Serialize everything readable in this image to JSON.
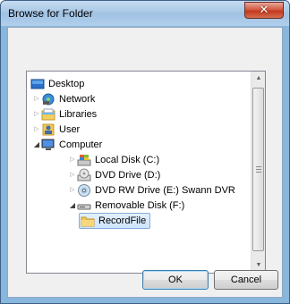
{
  "window": {
    "title": "Browse for Folder",
    "close_glyph": "✕"
  },
  "tree": {
    "items": [
      {
        "label": "Desktop",
        "icon": "desktop-icon",
        "expander": "none",
        "level": 0
      },
      {
        "label": "Network",
        "icon": "network-icon",
        "expander": "collapsed",
        "level": 1
      },
      {
        "label": "Libraries",
        "icon": "libraries-icon",
        "expander": "collapsed",
        "level": 1
      },
      {
        "label": "User",
        "icon": "user-folder-icon",
        "expander": "collapsed",
        "level": 1
      },
      {
        "label": "Computer",
        "icon": "computer-icon",
        "expander": "expanded",
        "level": 1
      },
      {
        "label": "Local Disk (C:)",
        "icon": "local-disk-icon",
        "expander": "collapsed",
        "level": 2
      },
      {
        "label": "DVD Drive (D:)",
        "icon": "dvd-drive-icon",
        "expander": "collapsed",
        "level": 2
      },
      {
        "label": "DVD RW Drive (E:) Swann DVR",
        "icon": "dvd-rw-drive-icon",
        "expander": "collapsed",
        "level": 2
      },
      {
        "label": "Removable Disk (F:)",
        "icon": "removable-disk-icon",
        "expander": "expanded",
        "level": 2
      },
      {
        "label": "RecordFile",
        "icon": "folder-icon",
        "expander": "none",
        "level": 3,
        "selected": true
      }
    ]
  },
  "buttons": {
    "ok_label": "OK",
    "cancel_label": "Cancel"
  },
  "colors": {
    "selection_fill": "#cfe5fb",
    "selection_border": "#84acdd",
    "frame": "#88b6dc"
  }
}
